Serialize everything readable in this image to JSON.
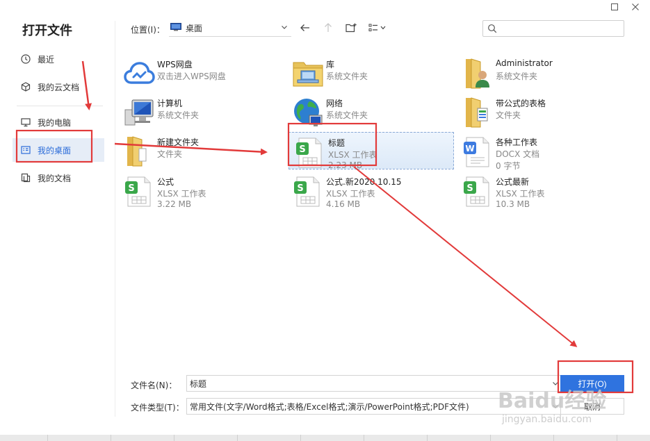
{
  "dialog": {
    "title": "打开文件"
  },
  "sidebar": {
    "items": [
      {
        "label": "最近",
        "icon": "clock-icon"
      },
      {
        "label": "我的云文档",
        "icon": "cloud-cube-icon"
      },
      {
        "label": "我的电脑",
        "icon": "monitor-icon"
      },
      {
        "label": "我的桌面",
        "icon": "desktop-icon",
        "active": true
      },
      {
        "label": "我的文档",
        "icon": "documents-icon"
      }
    ]
  },
  "toolbar": {
    "location_label": "位置(I)：",
    "location_value": "桌面",
    "search_placeholder": ""
  },
  "files": [
    {
      "name": "WPS网盘",
      "sub": "双击进入WPS网盘",
      "size": "",
      "icon": "wps-cloud-icon"
    },
    {
      "name": "库",
      "sub": "系统文件夹",
      "size": "",
      "icon": "library-folder-icon"
    },
    {
      "name": "Administrator",
      "sub": "系统文件夹",
      "size": "",
      "icon": "user-folder-icon"
    },
    {
      "name": "计算机",
      "sub": "系统文件夹",
      "size": "",
      "icon": "computer-icon"
    },
    {
      "name": "网络",
      "sub": "系统文件夹",
      "size": "",
      "icon": "network-globe-icon"
    },
    {
      "name": "带公式的表格",
      "sub": "文件夹",
      "size": "",
      "icon": "folder-icon"
    },
    {
      "name": "新建文件夹",
      "sub": "文件夹",
      "size": "",
      "icon": "folder-icon"
    },
    {
      "name": "标题",
      "sub": "XLSX 工作表",
      "size": "2.23 MB",
      "icon": "xlsx-file-icon",
      "selected": true
    },
    {
      "name": "各种工作表",
      "sub": "DOCX 文档",
      "size": "0 字节",
      "icon": "docx-file-icon"
    },
    {
      "name": "公式",
      "sub": "XLSX 工作表",
      "size": "3.22 MB",
      "icon": "xlsx-file-icon"
    },
    {
      "name": "公式.新2020.10.15",
      "sub": "XLSX 工作表",
      "size": "4.16 MB",
      "icon": "xlsx-file-icon"
    },
    {
      "name": "公式最新",
      "sub": "XLSX 工作表",
      "size": "10.3 MB",
      "icon": "xlsx-file-icon"
    }
  ],
  "footer": {
    "filename_label": "文件名(N)：",
    "filename_value": "标题",
    "filetype_label": "文件类型(T)：",
    "filetype_value": "常用文件(文字/Word格式;表格/Excel格式;演示/PowerPoint格式;PDF文件)",
    "open_label": "打开(O)",
    "cancel_label": "取消"
  },
  "watermark": {
    "brand": "Baidu经验",
    "url": "jingyan.baidu.com"
  },
  "colors": {
    "accent": "#2f73df",
    "annotation_red": "#e23a3a",
    "active_bg": "#e6edf7",
    "xlsx_green": "#3aa74a",
    "docx_blue": "#3d7be0"
  }
}
